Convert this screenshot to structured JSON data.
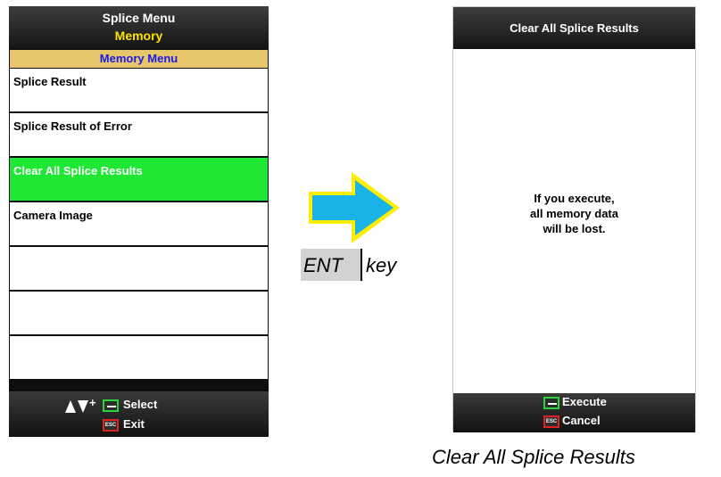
{
  "left_screen": {
    "title": "Splice Menu",
    "subtitle": "Memory",
    "menu_header": "Memory Menu",
    "items": [
      {
        "label": "Splice Result",
        "selected": false
      },
      {
        "label": "Splice Result of Error",
        "selected": false
      },
      {
        "label": "Clear All Splice Results",
        "selected": true
      },
      {
        "label": "Camera Image",
        "selected": false
      },
      {
        "label": "",
        "selected": false
      },
      {
        "label": "",
        "selected": false
      },
      {
        "label": "",
        "selected": false
      }
    ],
    "footer": {
      "plus": "+",
      "select_label": "Select",
      "esc_label": "ESC",
      "exit_label": "Exit"
    }
  },
  "transition": {
    "key_label": "ENT",
    "key_word": "key",
    "arrow_color": "#1ab3e8",
    "arrow_outline": "#ffee00"
  },
  "right_screen": {
    "title": "Clear All Splice Results",
    "message_lines": [
      "If you execute,",
      "all memory data",
      "will be lost."
    ],
    "footer": {
      "execute_label": "Execute",
      "esc_label": "ESC",
      "cancel_label": "Cancel"
    }
  },
  "caption": "Clear All Splice Results",
  "colors": {
    "selected_item": "#1ee832",
    "menu_header_bg": "#e6c56b",
    "menu_header_text": "#1a1ae6",
    "subtitle": "#ffe200",
    "ent_key_border": "#27d43b",
    "esc_key_border": "#e02222"
  }
}
